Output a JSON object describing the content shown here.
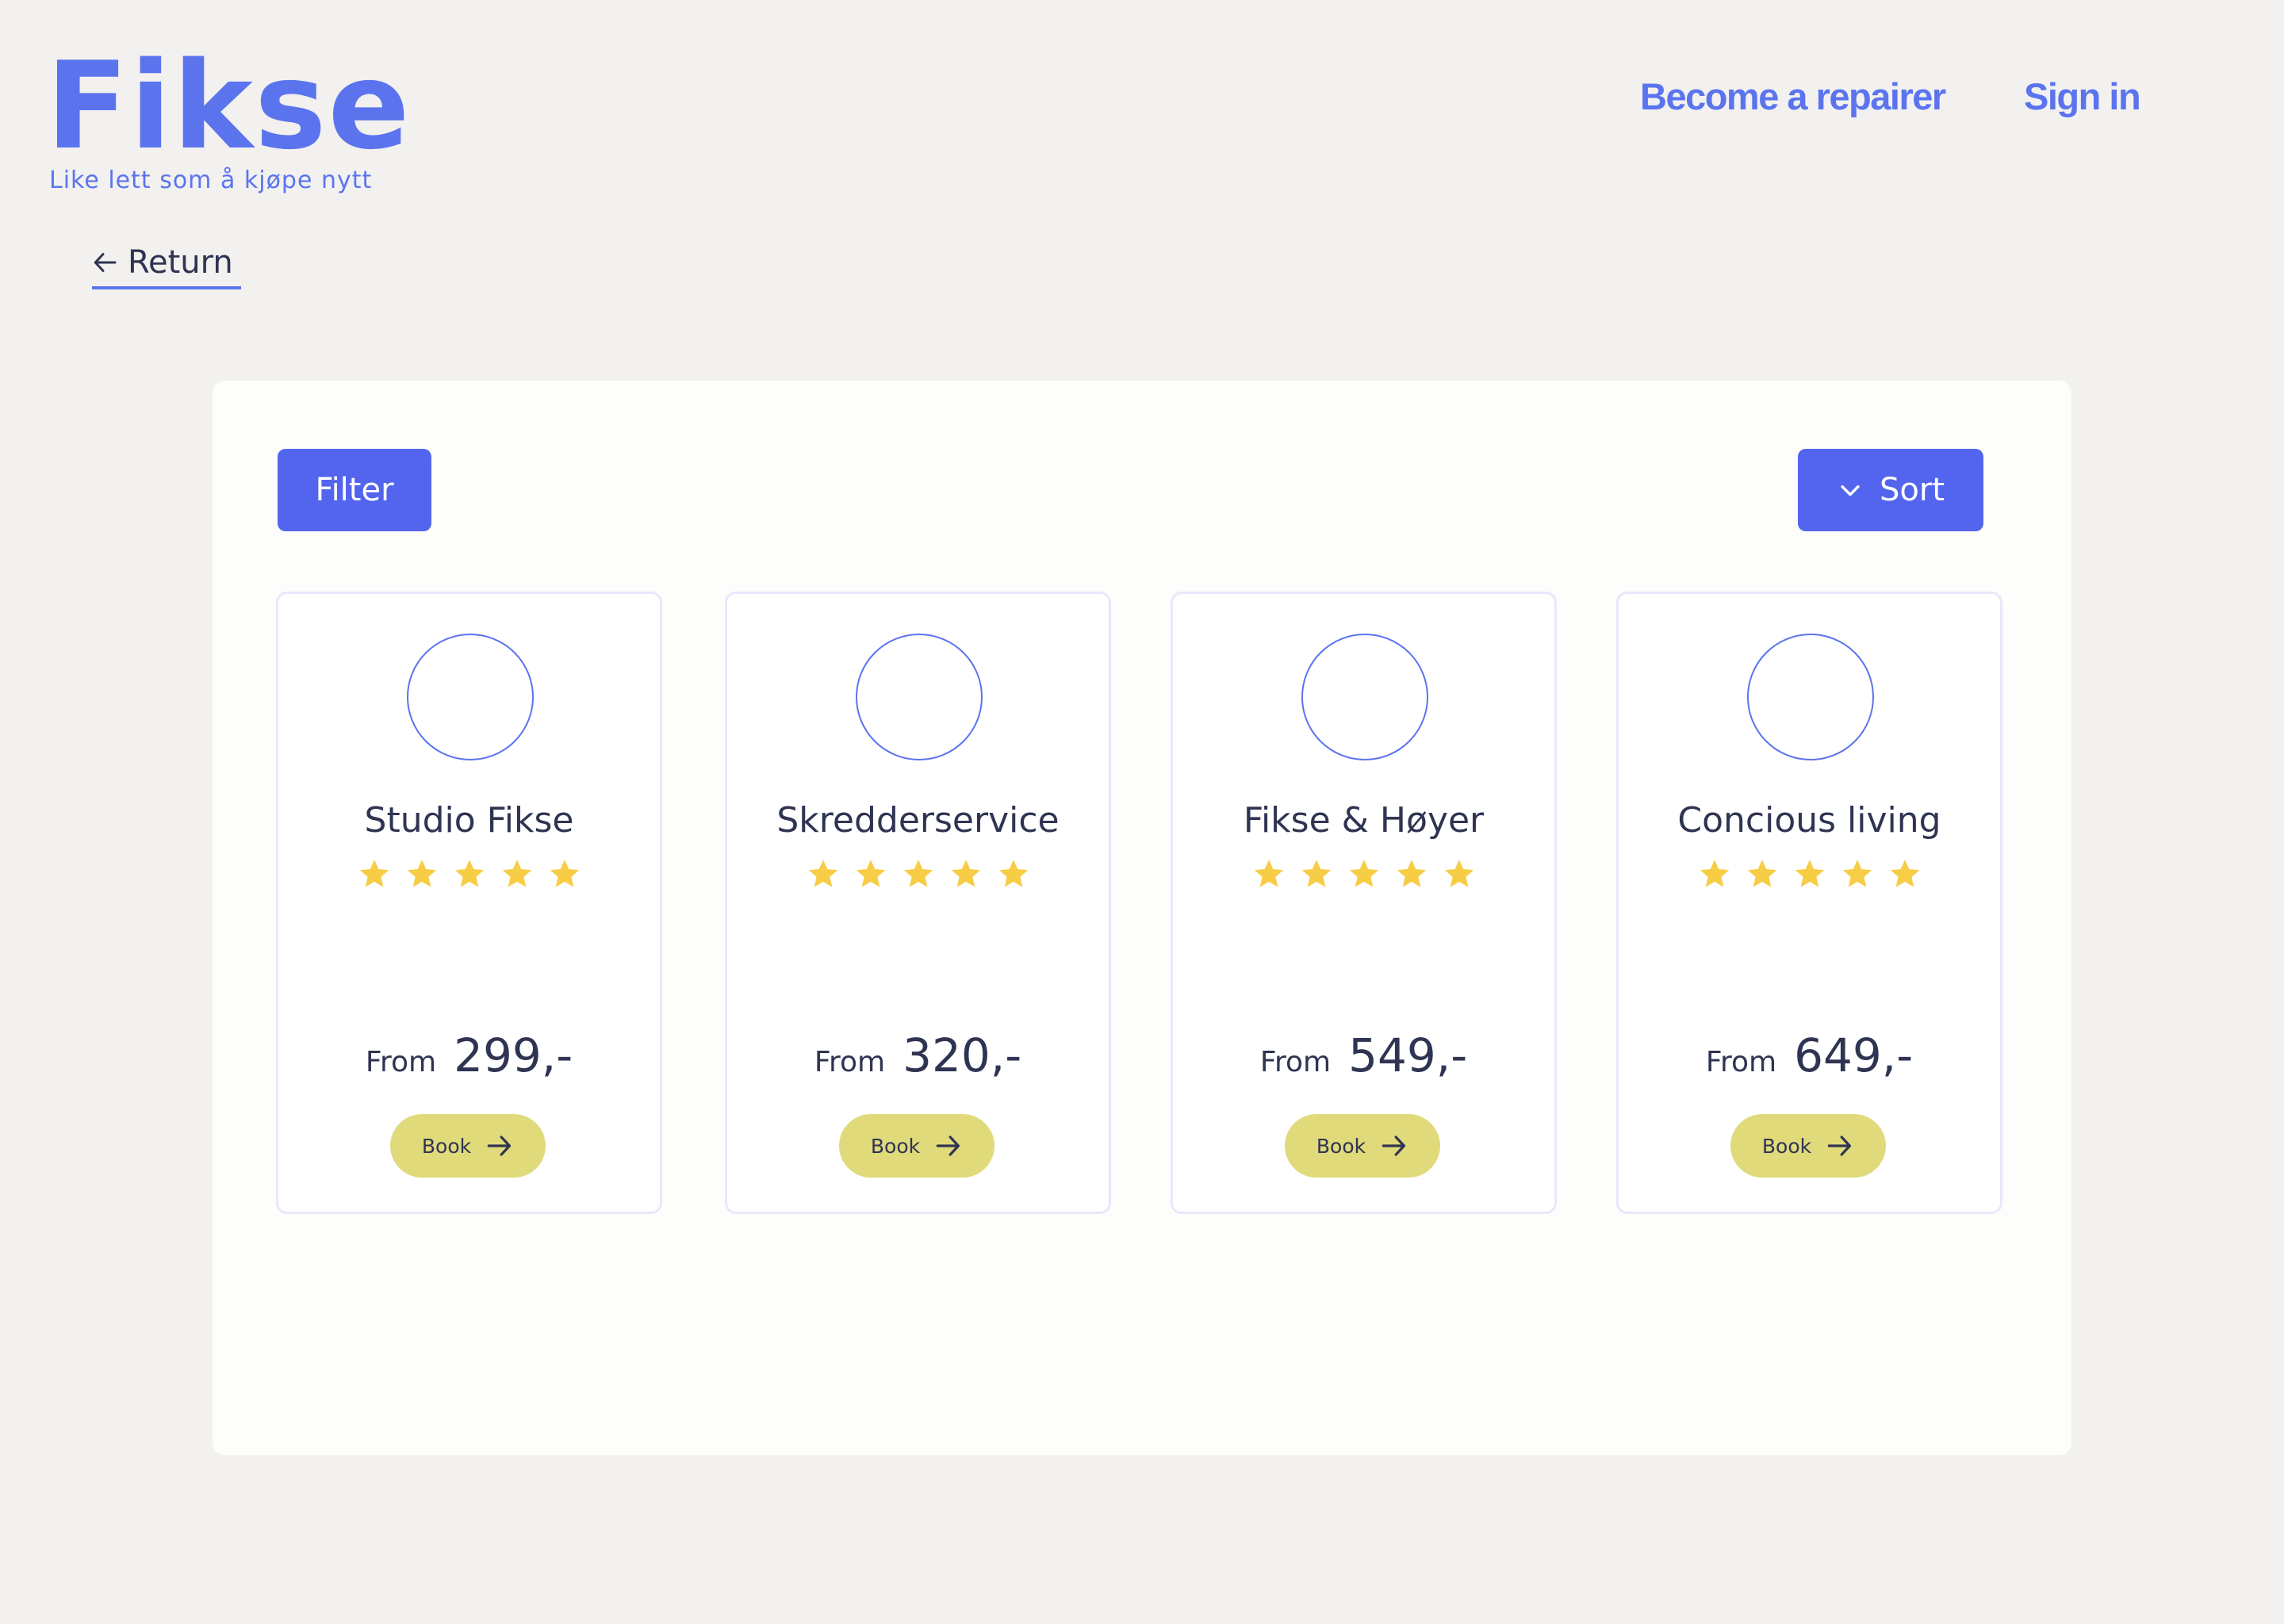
{
  "header": {
    "logo": "Fikse",
    "tagline": "Like lett som å kjøpe nytt",
    "nav": {
      "become_repairer": "Become a repairer",
      "sign_in": "Sign in"
    }
  },
  "return_link": {
    "label": "Return",
    "icon": "arrow-left-icon"
  },
  "toolbar": {
    "filter_label": "Filter",
    "sort_label": "Sort",
    "sort_icon": "chevron-down-icon"
  },
  "colors": {
    "brand": "#5b74ee",
    "button": "#5365ee",
    "book_button": "#e0da7b",
    "star": "#f7cd46",
    "text": "#2f3452"
  },
  "repairers": [
    {
      "name": "Studio Fikse",
      "rating": 5,
      "price_prefix": "From",
      "price": "299,-",
      "book_label": "Book"
    },
    {
      "name": "Skredderservice",
      "rating": 5,
      "price_prefix": "From",
      "price": "320,-",
      "book_label": "Book"
    },
    {
      "name": "Fikse & Høyer",
      "rating": 5,
      "price_prefix": "From",
      "price": "549,-",
      "book_label": "Book"
    },
    {
      "name": "Concious living",
      "rating": 5,
      "price_prefix": "From",
      "price": "649,-",
      "book_label": "Book"
    }
  ]
}
